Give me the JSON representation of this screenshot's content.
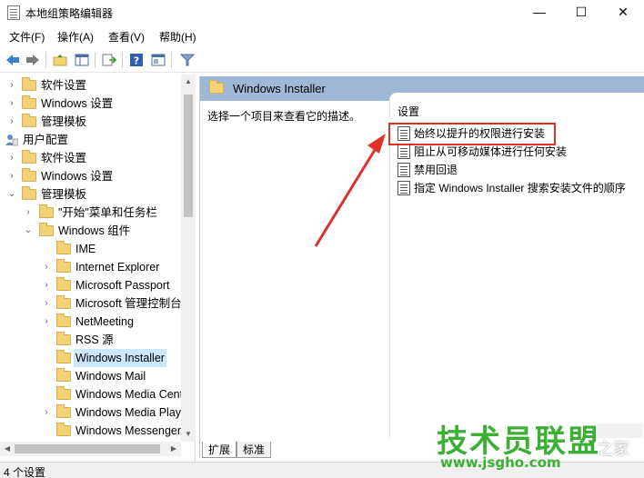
{
  "window": {
    "title": "本地组策略编辑器",
    "minimize": "—",
    "maximize": "☐",
    "close": "✕"
  },
  "menu": [
    "文件(F)",
    "操作(A)",
    "查看(V)",
    "帮助(H)"
  ],
  "toolbar": {
    "icons": [
      "back-arrow-icon",
      "forward-arrow-icon",
      "up-folder-icon",
      "show-hide-tree-icon",
      "export-list-icon",
      "help-icon",
      "properties-icon",
      "filter-icon"
    ]
  },
  "tree": {
    "items": [
      {
        "label": "软件设置",
        "expanded": false
      },
      {
        "label": "Windows 设置",
        "expanded": false
      },
      {
        "label": "管理模板",
        "expanded": false
      },
      {
        "label": "用户配置",
        "expanded": true
      },
      {
        "label": "软件设置",
        "expanded": false
      },
      {
        "label": "Windows 设置",
        "expanded": false
      },
      {
        "label": "管理模板",
        "expanded": true
      },
      {
        "label": "\"开始\"菜单和任务栏",
        "expanded": false
      },
      {
        "label": "Windows 组件",
        "expanded": true
      },
      {
        "label": "IME",
        "expanded": false
      },
      {
        "label": "Internet Explorer",
        "expanded": false
      },
      {
        "label": "Microsoft Passport",
        "expanded": false
      },
      {
        "label": "Microsoft 管理控制台",
        "expanded": false
      },
      {
        "label": "NetMeeting",
        "expanded": false
      },
      {
        "label": "RSS 源",
        "expanded": false
      },
      {
        "label": "Windows Installer",
        "selected": true
      },
      {
        "label": "Windows Mail",
        "expanded": false
      },
      {
        "label": "Windows Media Center",
        "expanded": false
      },
      {
        "label": "Windows Media Player",
        "expanded": false
      },
      {
        "label": "Windows Messenger",
        "expanded": false
      }
    ]
  },
  "right_pane": {
    "header": "Windows Installer",
    "description": "选择一个项目来查看它的描述。",
    "column_header": "设置",
    "settings": [
      "始终以提升的权限进行安装",
      "阻止从可移动媒体进行任何安装",
      "禁用回退",
      "指定 Windows Installer 搜索安装文件的顺序"
    ],
    "tabs": [
      "扩展",
      "标准"
    ]
  },
  "status": "4 个设置",
  "watermark": {
    "main": "技术员联盟",
    "url": "www.jsgho.com",
    "side": "之家"
  },
  "colors": {
    "header_bg": "#9fb8d8",
    "selection_bg": "#cce8ff",
    "highlight_red": "#e0302a",
    "watermark_green": "#3cb035"
  }
}
